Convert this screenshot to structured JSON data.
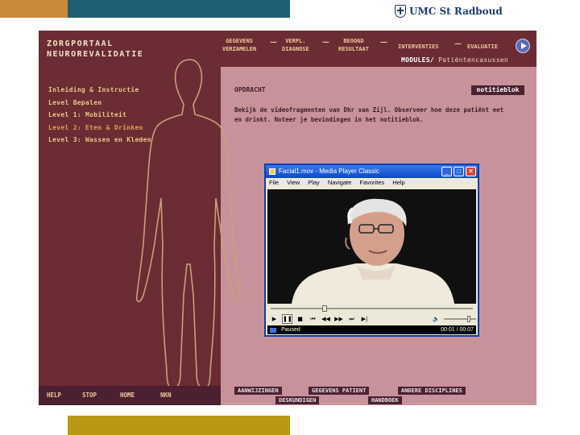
{
  "logo": {
    "text": "UMC St Radboud"
  },
  "app": {
    "title_line1": "ZORGPORTAAL",
    "title_line2": "NEUROREVALIDATIE",
    "steps": [
      {
        "line1": "GEGEVENS",
        "line2": "VERZAMELEN"
      },
      {
        "line1": "VERPL.",
        "line2": "DIAGNOSE"
      },
      {
        "line1": "BEOOGD",
        "line2": "RESULTAAT"
      },
      {
        "line1": "INTERVENTIES",
        "line2": ""
      },
      {
        "line1": "EVALUATIE",
        "line2": ""
      }
    ],
    "modules_label": "MODULES/",
    "modules_value": "Patiëntencasussen",
    "menu": [
      "Inleiding & Instructie",
      "Level Bepalen",
      "Level 1: Mobiliteit",
      "Level 2: Eten & Drinken",
      "Level 3: Wassen en Kleden"
    ],
    "active_menu_index": 3,
    "task_heading": "OPDRACHT",
    "task_text": "Bekijk de videofragmenten van Dhr van Zijl. Observeer hoe deze patiënt eet en drinkt. Noteer je bevindingen in het notitieblok.",
    "notes_button": "notitieblok",
    "footer_left": [
      "HELP",
      "STOP",
      "HOME",
      "NKN"
    ],
    "footer_tabs": [
      "AANWIJZINGEN",
      "GEGEVENS PATIENT",
      "ANDERE DISCIPLINES",
      "DESKUNDIGEN",
      "HANDBOEK"
    ]
  },
  "player": {
    "title": "Facial1.mov - Media Player Classic",
    "menu": [
      "File",
      "View",
      "Play",
      "Navigate",
      "Favorites",
      "Help"
    ],
    "seek_fraction": 0.26,
    "volume_fraction": 0.8,
    "status": "Paused",
    "time": "00:01 / 00:07"
  },
  "colors": {
    "frame_dark": "#6b2c34",
    "frame_pink": "#c8929a",
    "menu_text": "#e9c785",
    "xp_blue": "#0a48c8",
    "top_orange": "#c98a3a",
    "top_teal": "#1f5f73",
    "bottom_gold": "#b89812"
  }
}
